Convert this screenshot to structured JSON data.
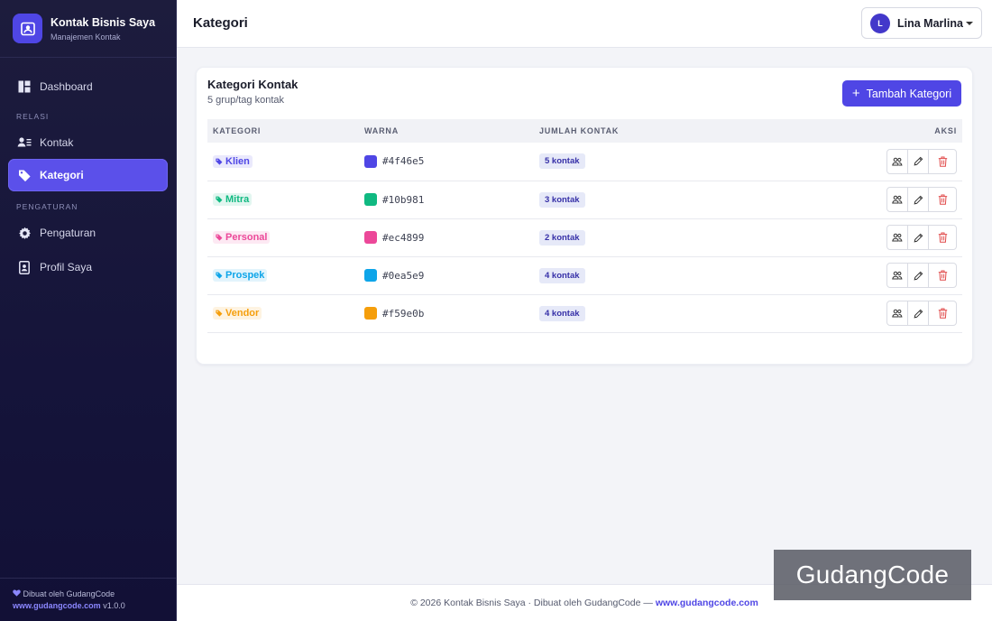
{
  "brand": {
    "name": "Kontak Bisnis Saya",
    "subtitle": "Manajemen Kontak"
  },
  "sidebar": {
    "items": [
      {
        "label": "Dashboard",
        "icon": "dashboard-icon"
      },
      {
        "section": "RELASI"
      },
      {
        "label": "Kontak",
        "icon": "contacts-icon"
      },
      {
        "label": "Kategori",
        "icon": "tag-icon",
        "active": true
      },
      {
        "section": "PENGATURAN"
      },
      {
        "label": "Pengaturan",
        "icon": "gear-icon"
      },
      {
        "label": "Profil Saya",
        "icon": "profile-icon"
      }
    ],
    "footer_text": "Dibuat oleh GudangCode",
    "footer_link": "www.gudangcode.com",
    "footer_version": "v1.0.0"
  },
  "header": {
    "title": "Kategori",
    "user_initial": "L",
    "user_name": "Lina Marlina"
  },
  "card": {
    "title": "Kategori Kontak",
    "subtitle": "5 grup/tag kontak",
    "add_button": "Tambah Kategori",
    "columns": [
      "KATEGORI",
      "WARNA",
      "JUMLAH KONTAK",
      "AKSI"
    ],
    "rows": [
      {
        "name": "Klien",
        "color": "#4f46e5",
        "hex": "#4f46e5",
        "count": "5 kontak"
      },
      {
        "name": "Mitra",
        "color": "#10b981",
        "hex": "#10b981",
        "count": "3 kontak"
      },
      {
        "name": "Personal",
        "color": "#ec4899",
        "hex": "#ec4899",
        "count": "2 kontak"
      },
      {
        "name": "Prospek",
        "color": "#0ea5e9",
        "hex": "#0ea5e9",
        "count": "4 kontak"
      },
      {
        "name": "Vendor",
        "color": "#f59e0b",
        "hex": "#f59e0b",
        "count": "4 kontak"
      }
    ]
  },
  "footer": {
    "text": "© 2026 Kontak Bisnis Saya · Dibuat oleh GudangCode —",
    "link": "www.gudangcode.com"
  },
  "watermark": "GudangCode",
  "colors": {
    "accent": "#4f46e5",
    "sidebar_bg": "#1d1c3d",
    "danger": "#e14b4b"
  }
}
